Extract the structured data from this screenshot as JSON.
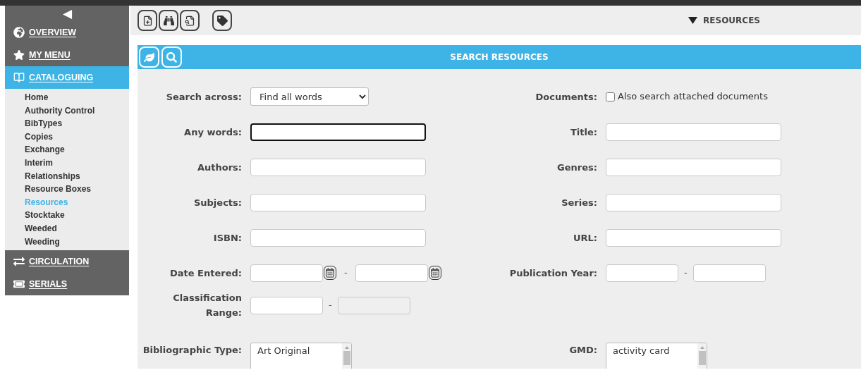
{
  "sidebar": {
    "collapse_label": "◀",
    "sections": [
      {
        "label": "OVERVIEW",
        "selected": false
      },
      {
        "label": "MY MENU",
        "selected": false
      },
      {
        "label": "CATALOGUING",
        "selected": true,
        "children": [
          {
            "label": "Home",
            "selected": false
          },
          {
            "label": "Authority Control",
            "selected": false
          },
          {
            "label": "BibTypes",
            "selected": false
          },
          {
            "label": "Copies",
            "selected": false
          },
          {
            "label": "Exchange",
            "selected": false
          },
          {
            "label": "Interim",
            "selected": false
          },
          {
            "label": "Relationships",
            "selected": false
          },
          {
            "label": "Resource Boxes",
            "selected": false
          },
          {
            "label": "Resources",
            "selected": true
          },
          {
            "label": "Stocktake",
            "selected": false
          },
          {
            "label": "Weeded",
            "selected": false
          },
          {
            "label": "Weeding",
            "selected": false
          }
        ]
      },
      {
        "label": "CIRCULATION",
        "selected": false
      },
      {
        "label": "SERIALS",
        "selected": false
      }
    ]
  },
  "toolbar": {
    "module_menu": "RESOURCES"
  },
  "panel": {
    "title": "SEARCH RESOURCES"
  },
  "rows": [
    {
      "left": {
        "label": "Search across:",
        "kind": "select",
        "value": "Find all words"
      },
      "right": {
        "label": "Documents:",
        "kind": "checkbox",
        "checked": false,
        "text": "Also search attached documents"
      }
    },
    {
      "left": {
        "label": "Any words:",
        "kind": "text",
        "focused": true
      },
      "right": {
        "label": "Title:",
        "kind": "text",
        "focused": false
      }
    },
    {
      "left": {
        "label": "Authors:",
        "kind": "text",
        "focused": false
      },
      "right": {
        "label": "Genres:",
        "kind": "text",
        "focused": false
      }
    },
    {
      "left": {
        "label": "Subjects:",
        "kind": "text",
        "focused": false
      },
      "right": {
        "label": "Series:",
        "kind": "text",
        "focused": false
      }
    },
    {
      "left": {
        "label": "ISBN:",
        "kind": "text",
        "focused": false
      },
      "right": {
        "label": "URL:",
        "kind": "text",
        "focused": false
      }
    },
    {
      "left": {
        "label": "Date Entered:",
        "kind": "date-range",
        "separator": "-"
      },
      "right": {
        "label": "Publication Year:",
        "kind": "range",
        "separator": "-",
        "disabled": false
      }
    },
    {
      "left": {
        "label": "Classification Range:",
        "kind": "range",
        "separator": "-",
        "disabled": true
      }
    },
    {
      "left": {
        "label": "Bibliographic Type:",
        "kind": "listbox",
        "items": [
          "Art Original"
        ]
      },
      "right": {
        "label": "GMD:",
        "kind": "listbox",
        "items": [
          "activity card"
        ]
      }
    }
  ]
}
